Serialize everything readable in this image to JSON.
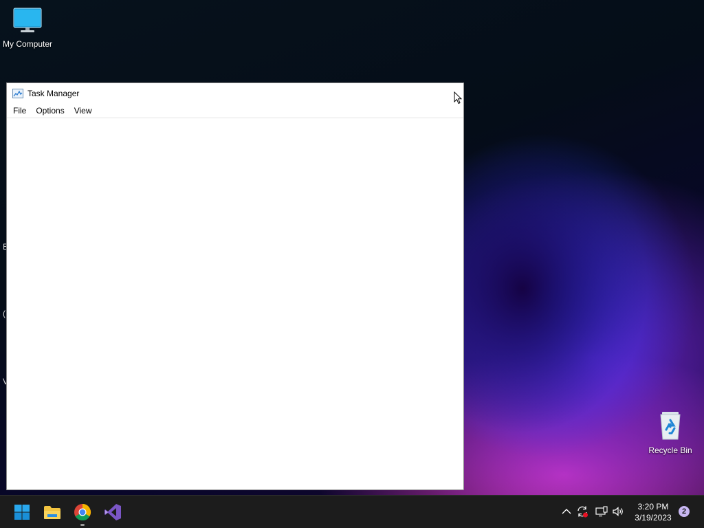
{
  "desktop": {
    "icons": [
      {
        "label": "My Computer",
        "icon": "monitor-icon"
      },
      {
        "label": "Recycle Bin",
        "icon": "recycle-bin-icon"
      }
    ],
    "edge_fragments": [
      "E",
      "(",
      "V"
    ]
  },
  "window": {
    "title": "Task Manager",
    "icon": "task-manager-icon",
    "menu": [
      "File",
      "Options",
      "View"
    ]
  },
  "taskbar": {
    "apps": [
      {
        "name": "Start",
        "icon": "windows-start-icon"
      },
      {
        "name": "File Explorer",
        "icon": "folder-icon"
      },
      {
        "name": "Google Chrome",
        "icon": "chrome-icon",
        "running": true
      },
      {
        "name": "Visual Studio",
        "icon": "visual-studio-icon"
      }
    ],
    "tray": {
      "icons": [
        "chevron-up-icon",
        "sync-icon",
        "network-icon",
        "volume-icon"
      ],
      "time": "3:20 PM",
      "date": "3/19/2023",
      "notification_count": "2"
    }
  },
  "colors": {
    "taskbar": "#1c1c1c",
    "window_bg": "#ffffff",
    "accent_blue": "#0078d4"
  }
}
